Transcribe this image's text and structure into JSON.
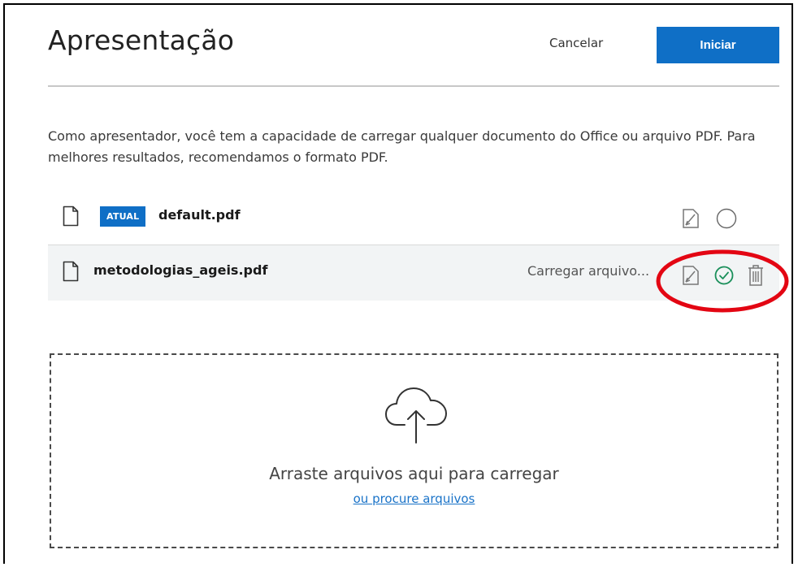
{
  "header": {
    "title": "Apresentação",
    "cancel_label": "Cancelar",
    "start_label": "Iniciar"
  },
  "description": "Como apresentador, você tem a capacidade de carregar qualquer documento do Office ou arquivo PDF. Para melhores resultados, recomendamos o formato PDF.",
  "files": [
    {
      "name": "default.pdf",
      "badge": "ATUAL",
      "status": "",
      "icons": [
        "file-icon",
        "edit-download-icon",
        "unselected-circle-icon"
      ]
    },
    {
      "name": "metodologias_ageis.pdf",
      "badge": "",
      "status": "Carregar arquivo...",
      "icons": [
        "file-icon",
        "edit-download-icon",
        "selected-check-icon",
        "trash-icon"
      ]
    }
  ],
  "dropzone": {
    "text": "Arraste arquivos aqui para carregar",
    "browse_label": "ou procure arquivos",
    "icon": "cloud-upload-icon"
  },
  "colors": {
    "primary": "#0f6fc6",
    "success": "#1a8f5a",
    "annotation": "#e30613"
  }
}
